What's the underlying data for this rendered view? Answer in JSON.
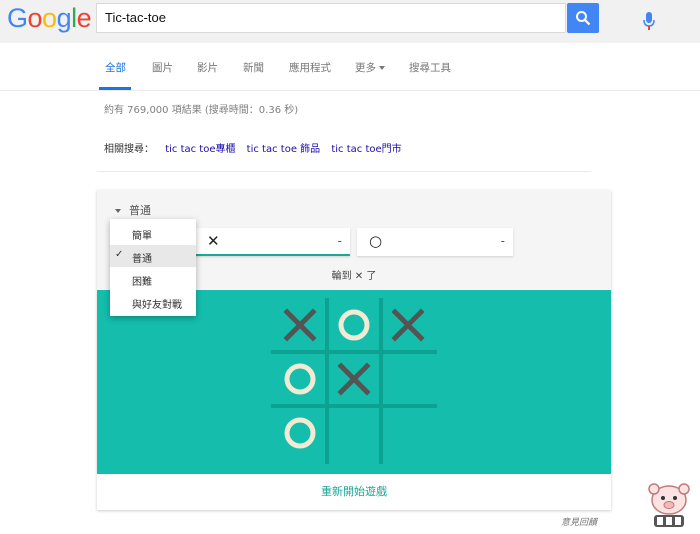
{
  "logo": {
    "letters": [
      {
        "ch": "G",
        "color": "#4285f4"
      },
      {
        "ch": "o",
        "color": "#ea4335"
      },
      {
        "ch": "o",
        "color": "#fbbc05"
      },
      {
        "ch": "g",
        "color": "#4285f4"
      },
      {
        "ch": "l",
        "color": "#34a853"
      },
      {
        "ch": "e",
        "color": "#ea4335"
      }
    ]
  },
  "search": {
    "query": "Tic-tac-toe",
    "mic_icon": "microphone-icon",
    "button_icon": "search-icon"
  },
  "tabs": [
    {
      "label": "全部",
      "active": true
    },
    {
      "label": "圖片"
    },
    {
      "label": "影片"
    },
    {
      "label": "新聞"
    },
    {
      "label": "應用程式"
    },
    {
      "label": "更多"
    },
    {
      "label": "搜尋工具"
    }
  ],
  "stats": "約有 769,000 項結果 (搜尋時間：0.36 秒)",
  "related": {
    "label": "相關搜尋：",
    "links": [
      "tic tac toe專櫃",
      "tic tac toe 飾品",
      "tic tac toe門市"
    ]
  },
  "game": {
    "difficulty": "普通",
    "difficulty_options": [
      {
        "label": "簡單",
        "checked": false
      },
      {
        "label": "普通",
        "checked": true
      },
      {
        "label": "困難",
        "checked": false
      },
      {
        "label": "與好友對戰",
        "checked": false
      }
    ],
    "player_x": {
      "symbol": "✕",
      "score": "-"
    },
    "player_o": {
      "symbol": "○",
      "score": "-"
    },
    "turn_prefix": "輪到",
    "turn_symbol": "✕",
    "turn_suffix": "了",
    "board": [
      "X",
      "O",
      "X",
      "O",
      "X",
      "",
      "O",
      "",
      ""
    ],
    "board_color": "#14bdac",
    "grid_color": "#0da192",
    "x_color": "#545454",
    "o_color": "#f2ebd3",
    "restart_label": "重新開始遊戲"
  },
  "feedback": "意見回饋",
  "accent_color": "#1a73e8"
}
